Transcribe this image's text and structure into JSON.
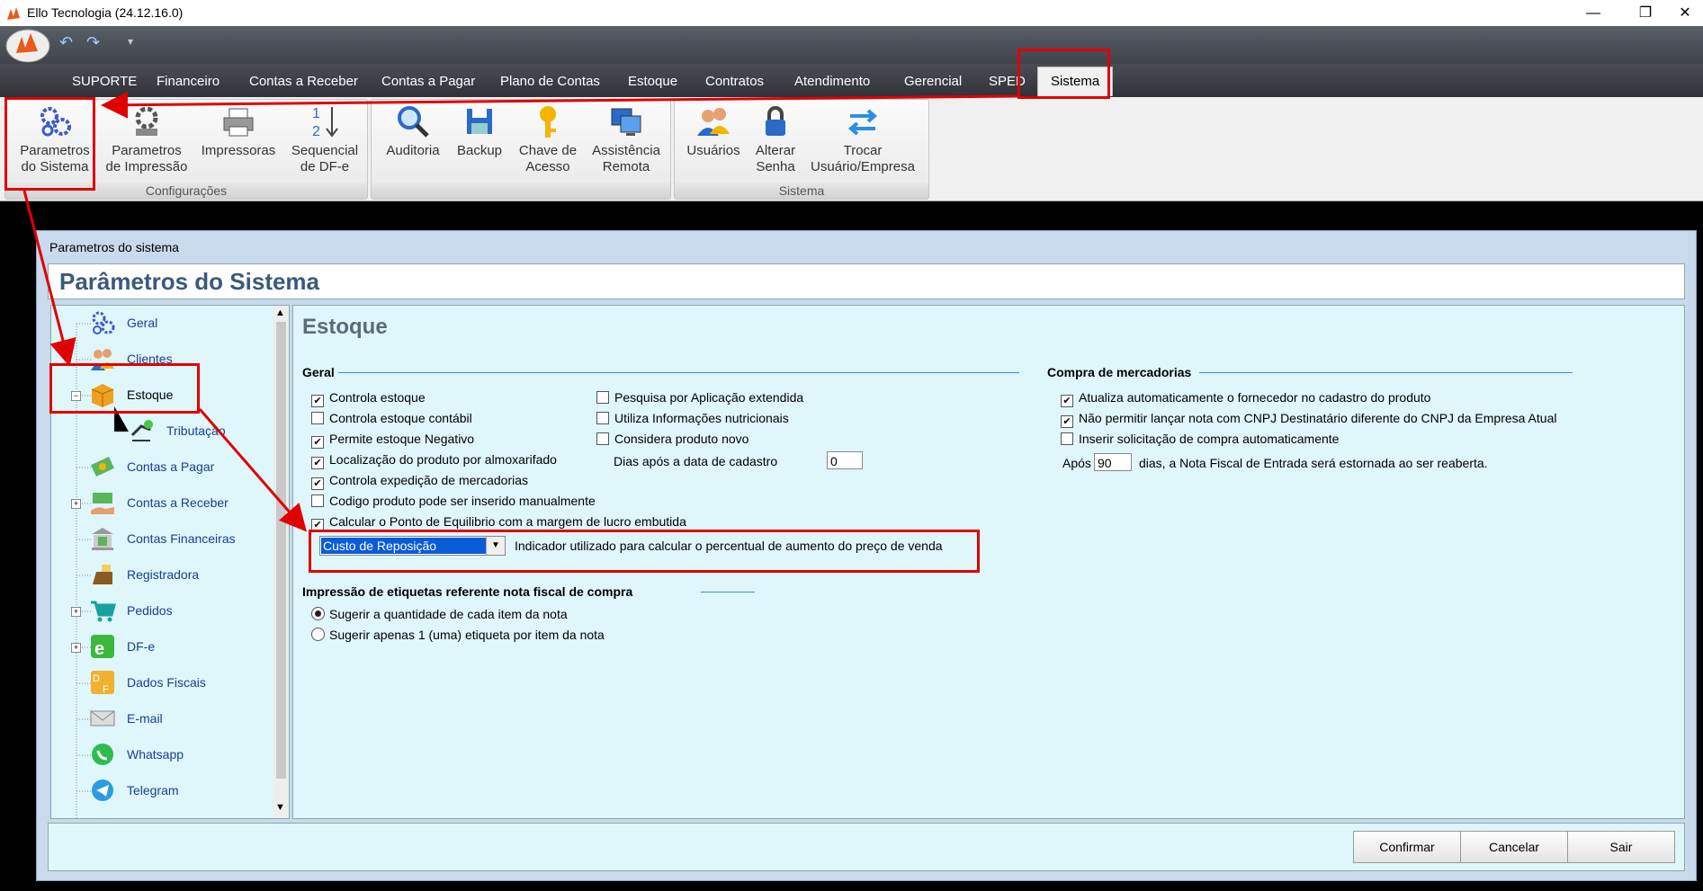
{
  "window": {
    "title": "Ello Tecnologia (24.12.16.0)"
  },
  "tabs": [
    "SUPORTE",
    "Financeiro",
    "Contas a Receber",
    "Contas a Pagar",
    "Plano de Contas",
    "Estoque",
    "Contratos",
    "Atendimento",
    "Gerencial",
    "SPED",
    "Sistema"
  ],
  "active_tab": "Sistema",
  "ribbon": {
    "groups": [
      {
        "label": "Configurações",
        "buttons": [
          {
            "line1": "Parametros",
            "line2": "do Sistema",
            "icon": "gears-icon"
          },
          {
            "line1": "Parametros",
            "line2": "de Impressão",
            "icon": "gear-print-icon"
          },
          {
            "line1": "Impressoras",
            "line2": "",
            "icon": "printer-icon"
          },
          {
            "line1": "Sequencial",
            "line2": "de DF-e",
            "icon": "sequence-icon"
          }
        ]
      },
      {
        "label": "",
        "buttons": [
          {
            "line1": "Auditoria",
            "line2": "",
            "icon": "magnifier-icon"
          },
          {
            "line1": "Backup",
            "line2": "",
            "icon": "floppy-icon"
          },
          {
            "line1": "Chave de",
            "line2": "Acesso",
            "icon": "key-icon"
          },
          {
            "line1": "Assistência",
            "line2": "Remota",
            "icon": "remote-desktop-icon"
          }
        ]
      },
      {
        "label": "Sistema",
        "buttons": [
          {
            "line1": "Usuários",
            "line2": "",
            "icon": "users-icon"
          },
          {
            "line1": "Alterar",
            "line2": "Senha",
            "icon": "lock-icon"
          },
          {
            "line1": "Trocar",
            "line2": "Usuário/Empresa",
            "icon": "swap-icon"
          }
        ]
      }
    ]
  },
  "dialog": {
    "window_title": "Parametros do sistema",
    "header": "Parâmetros do Sistema",
    "tree": [
      {
        "label": "Geral",
        "icon": "gears-icon"
      },
      {
        "label": "Clientes",
        "icon": "users-icon"
      },
      {
        "label": "Estoque",
        "icon": "box-icon",
        "selected": true
      },
      {
        "label": "Tributação",
        "icon": "tax-icon",
        "child": true
      },
      {
        "label": "Contas a Pagar",
        "icon": "money-icon"
      },
      {
        "label": "Contas a Receber",
        "icon": "money-hand-icon"
      },
      {
        "label": "Contas Financeiras",
        "icon": "bank-icon"
      },
      {
        "label": "Registradora",
        "icon": "cash-register-icon"
      },
      {
        "label": "Pedidos",
        "icon": "cart-icon"
      },
      {
        "label": "DF-e",
        "icon": "dfe-icon"
      },
      {
        "label": "Dados Fiscais",
        "icon": "fiscal-data-icon"
      },
      {
        "label": "E-mail",
        "icon": "envelope-icon"
      },
      {
        "label": "Whatsapp",
        "icon": "whatsapp-icon"
      },
      {
        "label": "Telegram",
        "icon": "telegram-icon"
      }
    ],
    "page_title": "Estoque",
    "geral": {
      "title": "Geral",
      "col1": [
        {
          "label": "Controla estoque",
          "checked": true
        },
        {
          "label": "Controla estoque contábil",
          "checked": false
        },
        {
          "label": "Permite estoque Negativo",
          "checked": true
        },
        {
          "label": "Localização do produto por almoxarifado",
          "checked": true
        },
        {
          "label": "Controla expedição de mercadorias",
          "checked": true
        },
        {
          "label": "Codigo produto pode ser inserido manualmente",
          "checked": false
        },
        {
          "label": "Calcular o Ponto de Equilibrio com a margem de lucro embutida",
          "checked": true
        }
      ],
      "col2": [
        {
          "label": "Pesquisa por Aplicação extendida",
          "checked": false
        },
        {
          "label": "Utiliza Informações nutricionais",
          "checked": false
        },
        {
          "label": "Considera produto novo",
          "checked": false
        }
      ],
      "dias_label": "Dias após a data de cadastro",
      "dias_value": "0",
      "combo_value": "Custo de Reposição",
      "combo_desc": "Indicador utilizado para calcular o percentual de aumento do preço de venda"
    },
    "compra": {
      "title": "Compra de mercadorias",
      "items": [
        {
          "label": "Atualiza automaticamente o fornecedor no cadastro do produto",
          "checked": true
        },
        {
          "label": "Não permitir lançar nota com CNPJ Destinatário diferente do CNPJ da Empresa Atual",
          "checked": true
        },
        {
          "label": "Inserir solicitação de compra automaticamente",
          "checked": false
        }
      ],
      "apos_label": "Após",
      "apos_value": "90",
      "apos_suffix": "dias, a Nota Fiscal de Entrada será estornada ao ser reaberta."
    },
    "etiquetas": {
      "title": "Impressão de etiquetas referente nota fiscal de compra",
      "options": [
        {
          "label": "Sugerir a quantidade de cada item da nota",
          "selected": true
        },
        {
          "label": "Sugerir apenas 1 (uma) etiqueta por item da nota",
          "selected": false
        }
      ]
    },
    "buttons": {
      "confirm": "Confirmar",
      "cancel": "Cancelar",
      "exit": "Sair"
    }
  },
  "colors": {
    "annotation": "#e00000",
    "selection": "#0a5bd8",
    "panel": "#dff6fb"
  }
}
